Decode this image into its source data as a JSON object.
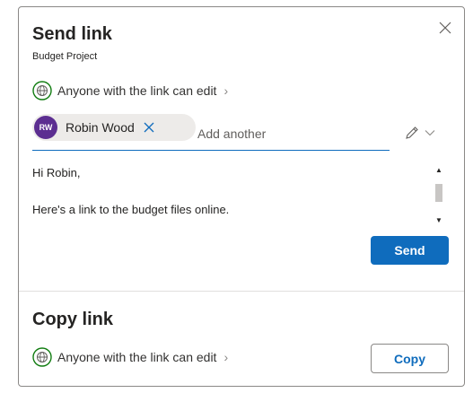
{
  "dialog": {
    "title": "Send link",
    "subtitle": "Budget Project"
  },
  "send_section": {
    "permission": {
      "label": "Anyone with the link can edit",
      "chevron": "›",
      "icon": "globe-icon"
    },
    "recipient": {
      "initials": "RW",
      "name": "Robin Wood",
      "avatar_color": "#5c2e91"
    },
    "add_another_placeholder": "Add another",
    "message_lines": [
      "Hi Robin,",
      "Here's a link to the budget files online."
    ],
    "send_label": "Send"
  },
  "copy_section": {
    "title": "Copy link",
    "permission": {
      "label": "Anyone with the link can edit",
      "chevron": "›",
      "icon": "globe-icon"
    },
    "copy_label": "Copy"
  },
  "colors": {
    "accent": "#0f6cbd",
    "globe": "#107c10"
  }
}
